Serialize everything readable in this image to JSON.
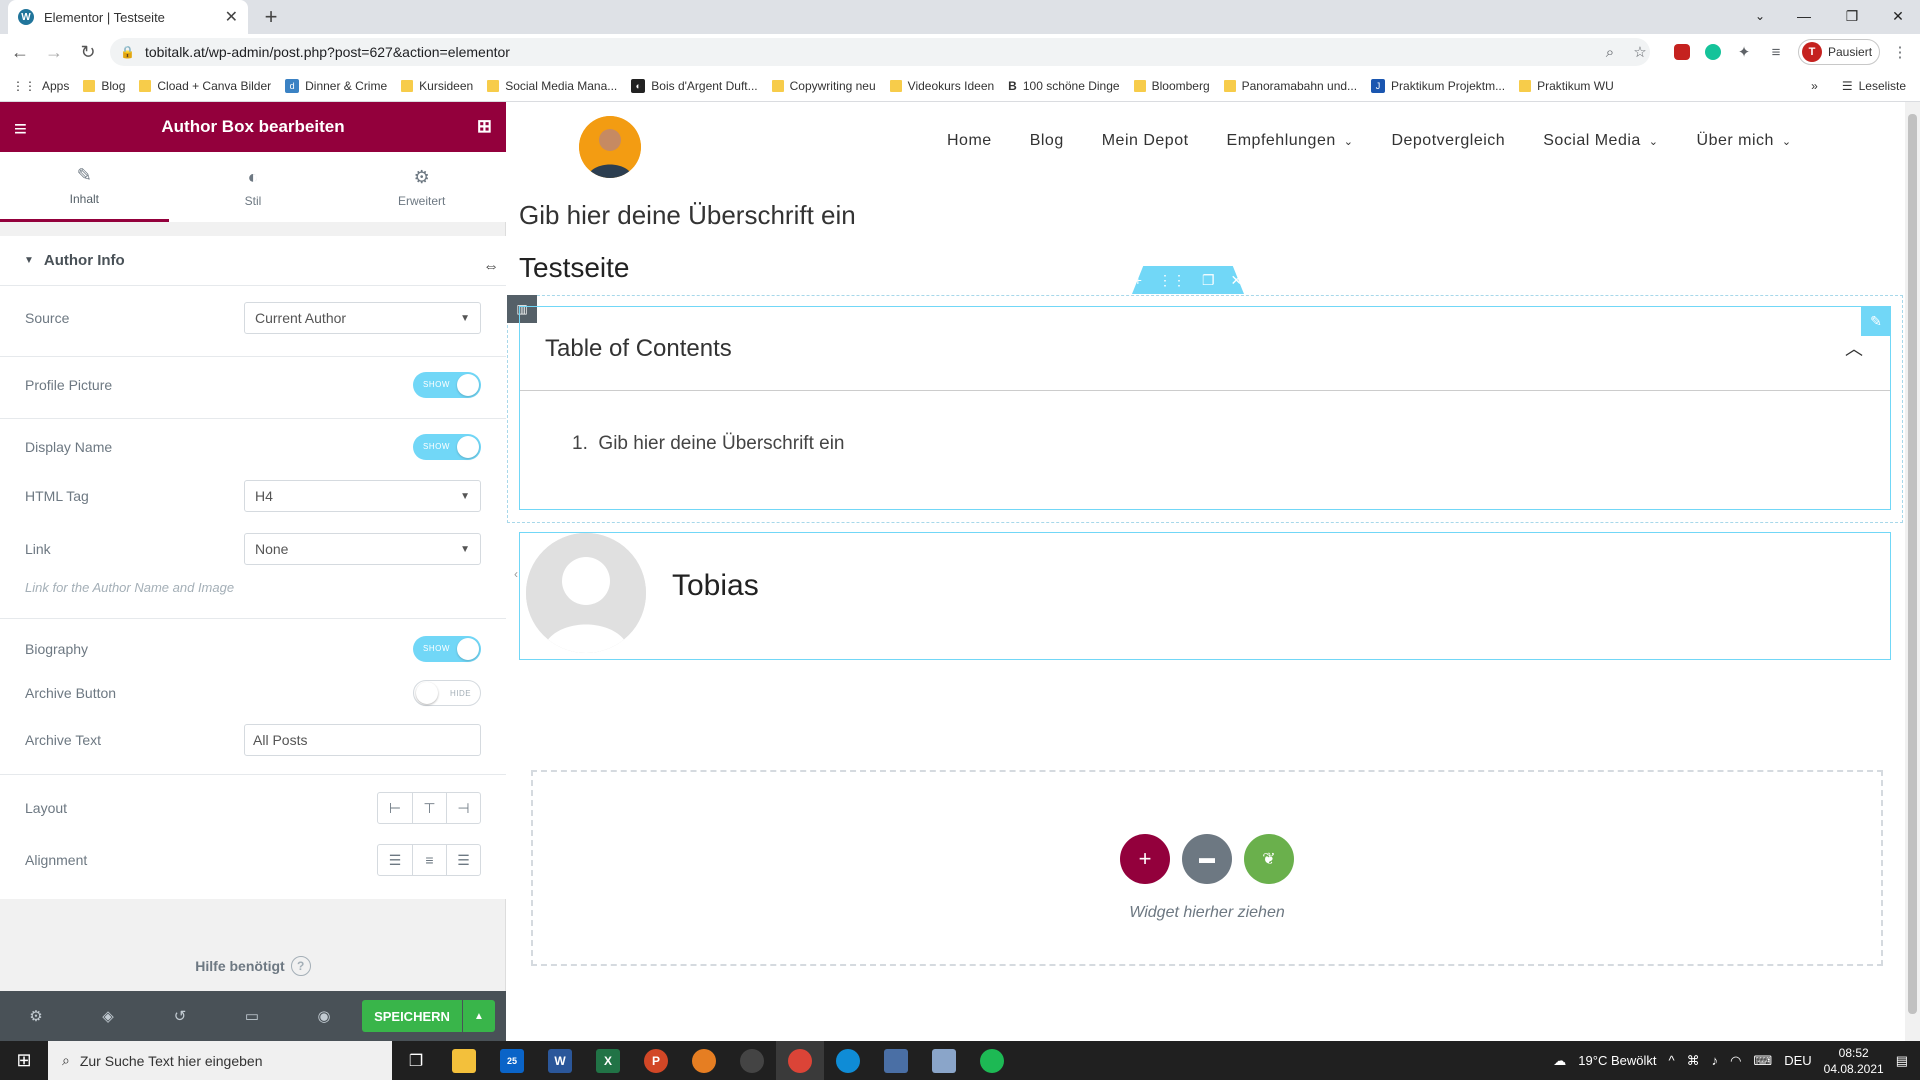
{
  "browser": {
    "tab_title": "Elementor | Testseite",
    "url": "tobitalk.at/wp-admin/post.php?post=627&action=elementor",
    "profile_label": "Pausiert",
    "profile_initial": "T",
    "bookmarks": [
      "Apps",
      "Blog",
      "Cload + Canva Bilder",
      "Dinner & Crime",
      "Kursideen",
      "Social Media Mana...",
      "Bois d'Argent Duft...",
      "Copywriting neu",
      "Videokurs Ideen",
      "100 schöne Dinge",
      "Bloomberg",
      "Panoramabahn und...",
      "Praktikum Projektm...",
      "Praktikum WU"
    ],
    "reading_list": "Leseliste"
  },
  "panel": {
    "title": "Author Box bearbeiten",
    "tabs": [
      {
        "label": "Inhalt",
        "icon": "pencil-icon"
      },
      {
        "label": "Stil",
        "icon": "contrast-icon"
      },
      {
        "label": "Erweitert",
        "icon": "gear-icon"
      }
    ],
    "section_title": "Author Info",
    "source_label": "Source",
    "source_value": "Current Author",
    "profile_picture_label": "Profile Picture",
    "display_name_label": "Display Name",
    "toggle_show": "SHOW",
    "toggle_hide": "HIDE",
    "html_tag_label": "HTML Tag",
    "html_tag_value": "H4",
    "link_label": "Link",
    "link_value": "None",
    "link_hint": "Link for the Author Name and Image",
    "biography_label": "Biography",
    "archive_button_label": "Archive Button",
    "archive_text_label": "Archive Text",
    "archive_text_value": "All Posts",
    "layout_label": "Layout",
    "alignment_label": "Alignment",
    "help_label": "Hilfe benötigt",
    "save_label": "SPEICHERN"
  },
  "preview": {
    "nav": [
      {
        "label": "Home",
        "dropdown": false
      },
      {
        "label": "Blog",
        "dropdown": false
      },
      {
        "label": "Mein Depot",
        "dropdown": false
      },
      {
        "label": "Empfehlungen",
        "dropdown": true
      },
      {
        "label": "Depotvergleich",
        "dropdown": false
      },
      {
        "label": "Social Media",
        "dropdown": true
      },
      {
        "label": "Über mich",
        "dropdown": true
      }
    ],
    "heading": "Gib hier deine Überschrift ein",
    "page_title": "Testseite",
    "toc_title": "Table of Contents",
    "toc_item_number": "1.",
    "toc_item": "Gib hier deine Überschrift ein",
    "author_name": "Tobias",
    "drop_text": "Widget hierher ziehen"
  },
  "taskbar": {
    "search_placeholder": "Zur Suche Text hier eingeben",
    "weather": "19°C  Bewölkt",
    "language": "DEU",
    "time": "08:52",
    "date": "04.08.2021",
    "mail_badge": "25"
  },
  "colors": {
    "elementor_accent": "#93003c",
    "save_green": "#39b54a",
    "selection_blue": "#71d7f7"
  }
}
